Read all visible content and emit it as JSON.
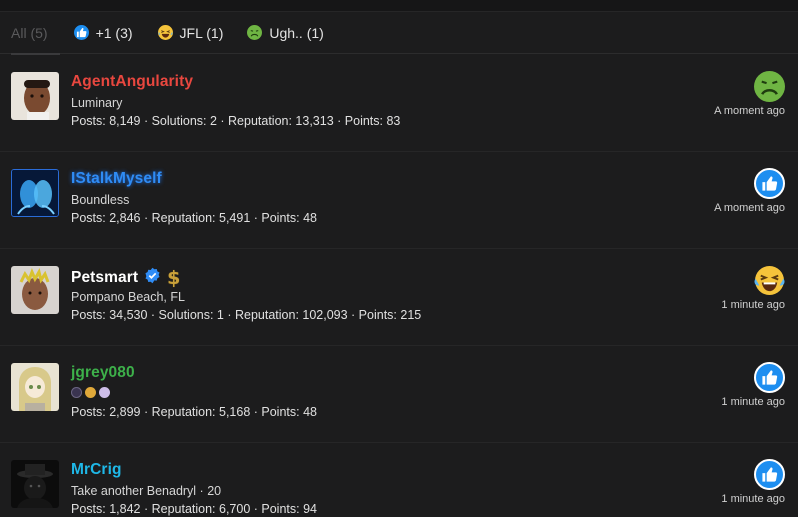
{
  "tabs": [
    {
      "label": "All (5)"
    },
    {
      "label": "+1 (3)"
    },
    {
      "label": "JFL (1)"
    },
    {
      "label": "Ugh.. (1)"
    }
  ],
  "users": [
    {
      "name": "AgentAngularity",
      "subtitle": "Luminary",
      "stats": "Posts: 8,149 · Solutions: 2 · Reputation: 13,313 · Points: 83",
      "time": "A moment ago",
      "name_color": "#e8473f",
      "reaction": "ugh-emoji"
    },
    {
      "name": "IStalkMyself",
      "subtitle": "Boundless",
      "stats": "Posts: 2,846 · Reputation: 5,491 · Points: 48",
      "time": "A moment ago",
      "name_color": "#2f8cf5",
      "reaction": "thumbs-up"
    },
    {
      "name": "Petsmart",
      "subtitle": "Pompano Beach, FL",
      "stats": "Posts: 34,530 · Solutions: 1 · Reputation: 102,093 · Points: 215",
      "time": "1 minute ago",
      "name_color": "#ffffff",
      "reaction": "jfl-emoji"
    },
    {
      "name": "jgrey080",
      "subtitle": "",
      "stats": "Posts: 2,899 · Reputation: 5,168 · Points: 48",
      "time": "1 minute ago",
      "name_color": "#3db04a",
      "reaction": "thumbs-up"
    },
    {
      "name": "MrCrig",
      "subtitle": "Take another Benadryl · 20",
      "stats": "Posts: 1,842 · Reputation: 6,700 · Points: 94",
      "time": "1 minute ago",
      "name_color": "#1fb8e8",
      "reaction": "thumbs-up"
    }
  ]
}
